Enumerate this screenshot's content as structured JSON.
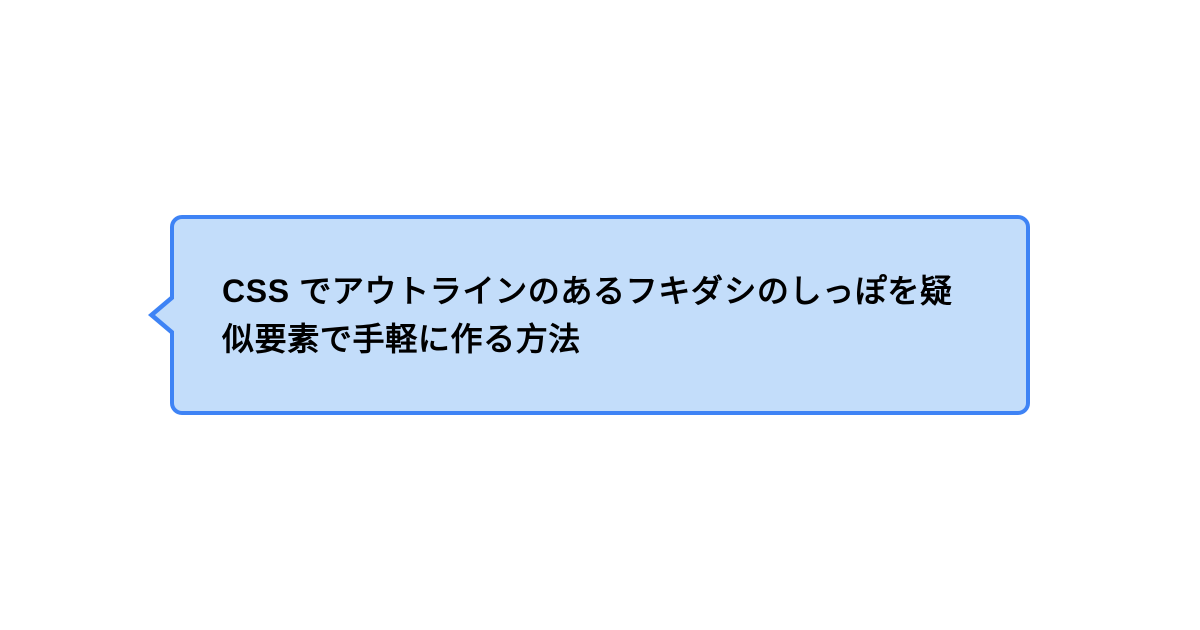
{
  "bubble": {
    "text": "CSS でアウトラインのあるフキダシのしっぽを疑似要素で手軽に作る方法",
    "colors": {
      "border": "#3e83f5",
      "background": "#c3ddfa",
      "text": "#000000"
    }
  }
}
